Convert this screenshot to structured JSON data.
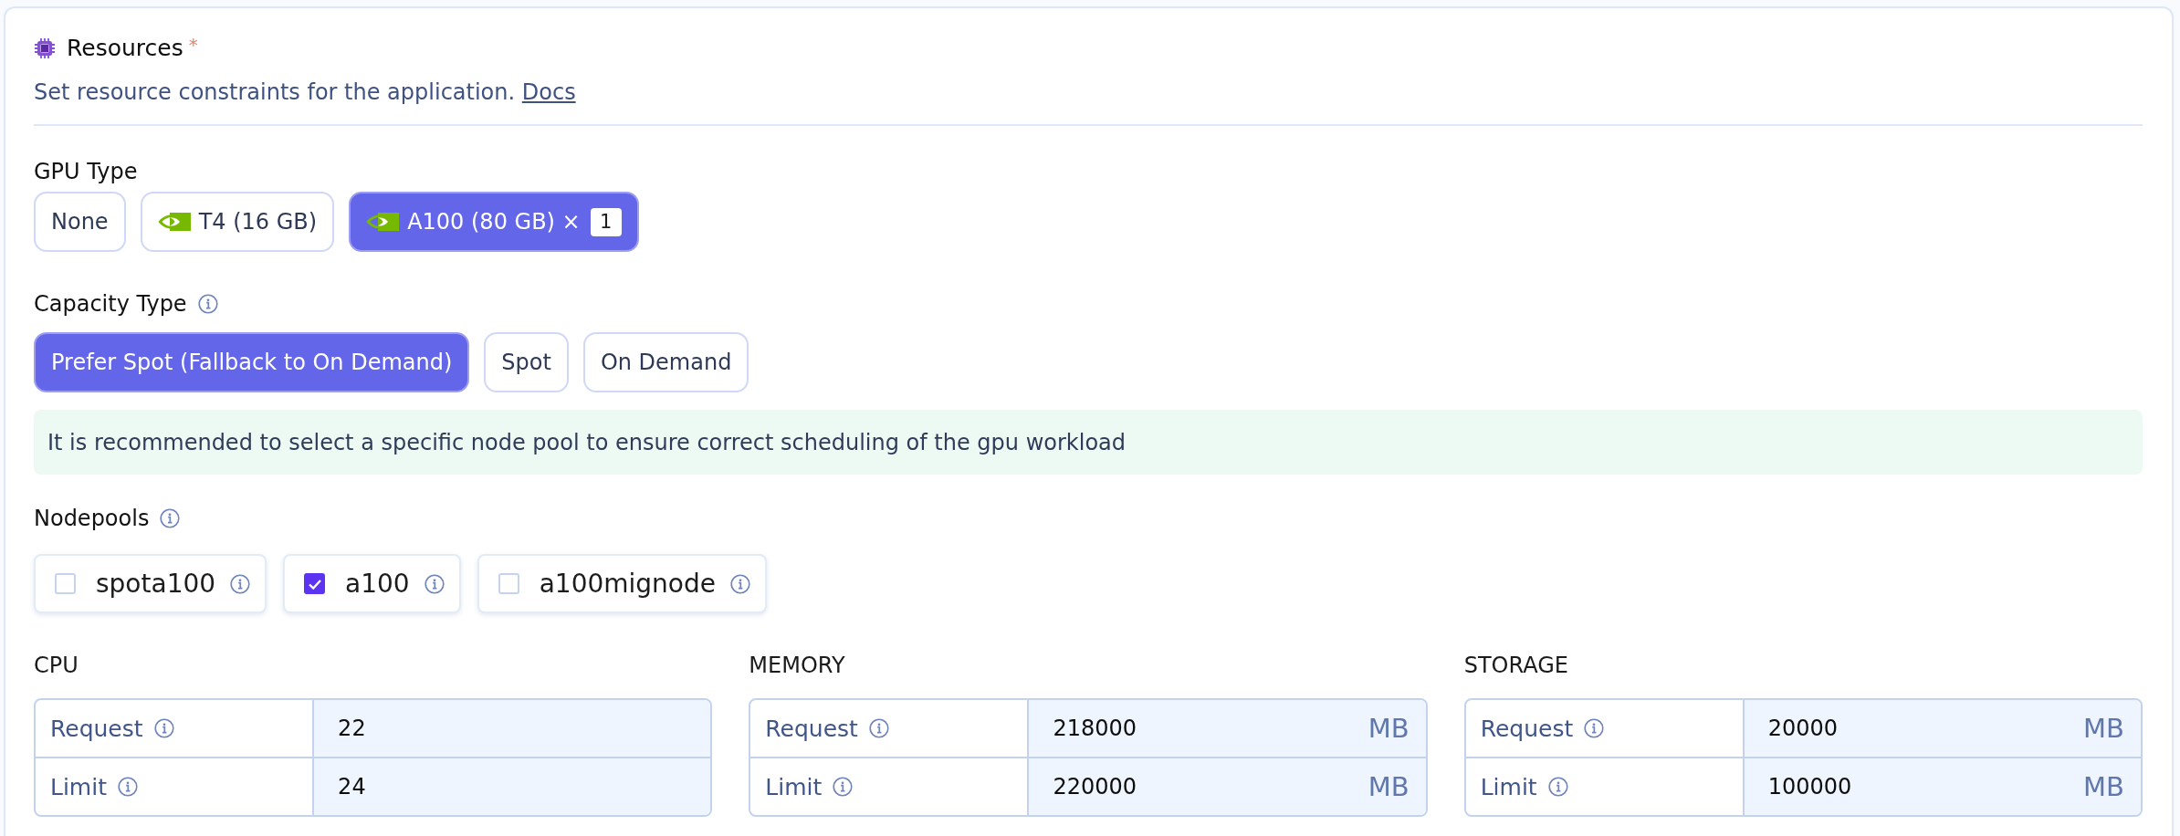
{
  "section": {
    "title": "Resources",
    "required_mark": "*",
    "description": "Set resource constraints for the application.",
    "docs_link": "Docs"
  },
  "gpu_type": {
    "label": "GPU Type",
    "info": false,
    "options": [
      {
        "label": "None",
        "kind": "plain",
        "selected": false
      },
      {
        "label": "T4 (16 GB)",
        "kind": "gpu",
        "selected": false
      },
      {
        "label": "A100 (80 GB) ×",
        "kind": "gpu",
        "selected": true,
        "count": "1"
      }
    ]
  },
  "capacity_type": {
    "label": "Capacity Type",
    "info": true,
    "options": [
      {
        "label": "Prefer Spot (Fallback to On Demand)",
        "selected": true
      },
      {
        "label": "Spot",
        "selected": false
      },
      {
        "label": "On Demand",
        "selected": false
      }
    ]
  },
  "notice": "It is recommended to select a specific node pool to ensure correct scheduling of the gpu workload",
  "nodepools": {
    "label": "Nodepools",
    "info": true,
    "items": [
      {
        "name": "spota100",
        "checked": false
      },
      {
        "name": "a100",
        "checked": true
      },
      {
        "name": "a100mignode",
        "checked": false
      }
    ]
  },
  "resources": [
    {
      "title": "CPU",
      "rows": [
        {
          "label": "Request",
          "value": "22"
        },
        {
          "label": "Limit",
          "value": "24"
        }
      ]
    },
    {
      "title": "MEMORY",
      "rows": [
        {
          "label": "Request",
          "value": "218000",
          "unit": "MB"
        },
        {
          "label": "Limit",
          "value": "220000",
          "unit": "MB"
        }
      ]
    },
    {
      "title": "STORAGE",
      "rows": [
        {
          "label": "Request",
          "value": "20000",
          "unit": "MB"
        },
        {
          "label": "Limit",
          "value": "100000",
          "unit": "MB"
        }
      ]
    }
  ]
}
